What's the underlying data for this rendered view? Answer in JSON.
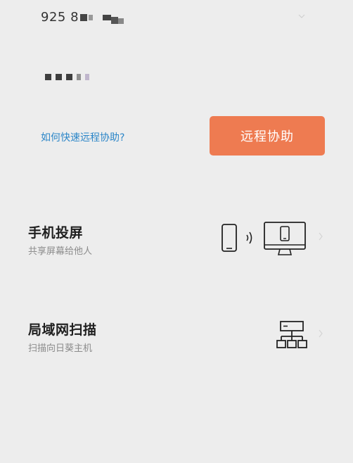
{
  "device": {
    "id_prefix": "925 8",
    "chevron_icon": "chevron-down-icon"
  },
  "password": {
    "masked": true
  },
  "help": {
    "link_text": "如何快速远程协助?"
  },
  "assist_button": {
    "label": "远程协助",
    "color": "#ee7b51"
  },
  "features": {
    "screen_cast": {
      "title": "手机投屏",
      "subtitle": "共享屏幕给他人",
      "icon": "phone-to-monitor-icon"
    },
    "lan_scan": {
      "title": "局域网扫描",
      "subtitle": "扫描向日葵主机",
      "icon": "network-topology-icon"
    }
  },
  "colors": {
    "background": "#ededed",
    "link": "#2c86c8",
    "accent": "#ee7b51"
  }
}
